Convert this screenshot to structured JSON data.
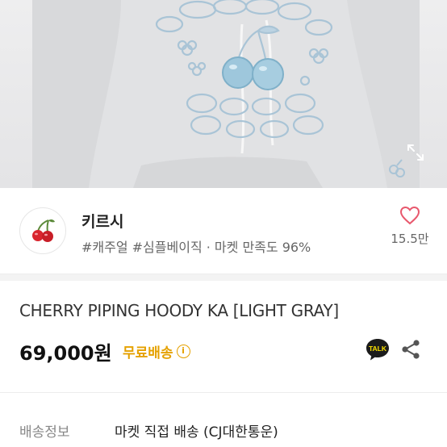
{
  "photo": {
    "alt_icon": "hoodie-photo",
    "expand_icon": "expand-icon"
  },
  "shop": {
    "name": "키르시",
    "tags": "#캐주얼 #심플베이직 · 마켓 만족도 96%",
    "like_count": "15.5만",
    "logo_icon": "cherry-icon",
    "accent": "#e8586d"
  },
  "product": {
    "title": "CHERRY PIPING HOODY KA [LIGHT GRAY]",
    "price": "69,000원",
    "shipping_badge": "무료배송",
    "shipping_color": "#e5a100",
    "talk_label": "TALK"
  },
  "shipping": {
    "label": "배송정보",
    "value": "마켓 직접 배송 (CJ대한통운)"
  }
}
